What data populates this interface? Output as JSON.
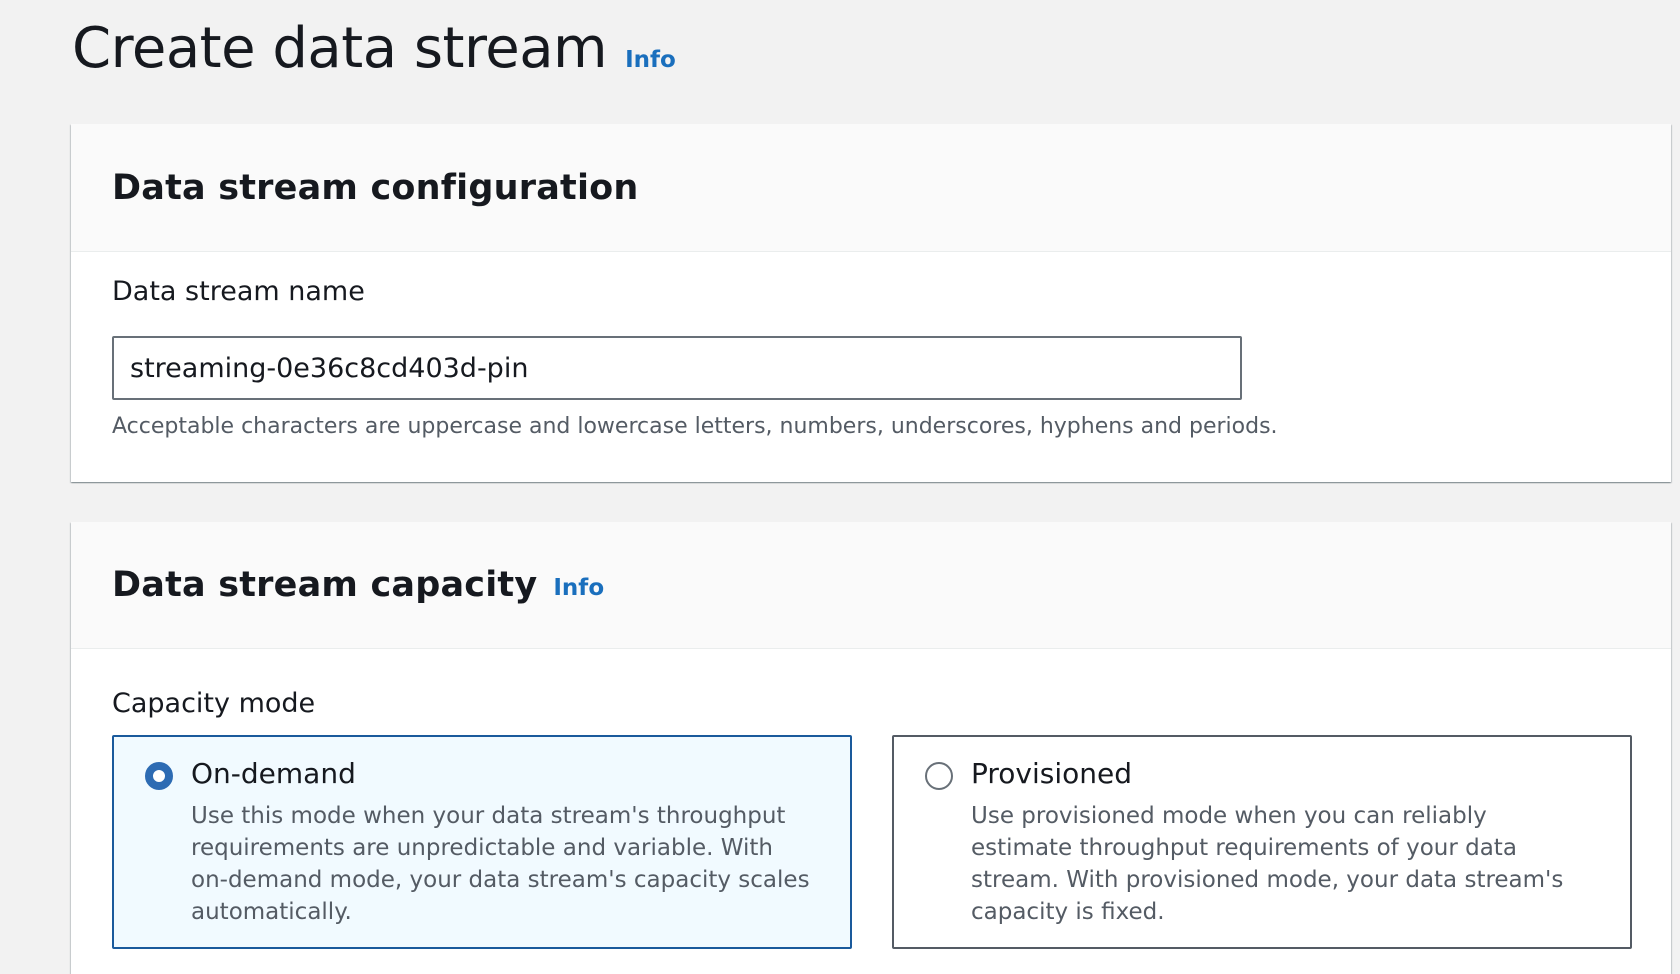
{
  "page": {
    "title": "Create data stream",
    "info_label": "Info"
  },
  "config_panel": {
    "title": "Data stream configuration",
    "name_field": {
      "label": "Data stream name",
      "value": "streaming-0e36c8cd403d-pin",
      "hint": "Acceptable characters are uppercase and lowercase letters, numbers, underscores, hyphens and periods."
    }
  },
  "capacity_panel": {
    "title": "Data stream capacity",
    "info_label": "Info",
    "mode_label": "Capacity mode",
    "options": [
      {
        "label": "On-demand",
        "description": "Use this mode when your data stream's throughput requirements are unpredictable and variable. With on-demand mode, your data stream's capacity scales automatically.",
        "selected": true
      },
      {
        "label": "Provisioned",
        "description": "Use provisioned mode when you can reliably estimate throughput requirements of your data stream. With provisioned mode, your data stream's capacity is fixed.",
        "selected": false
      }
    ]
  },
  "colors": {
    "background": "#f2f2f2",
    "link": "#1a6fbd",
    "selected_border": "#1a5a9c",
    "selected_fill": "#f1faff"
  }
}
